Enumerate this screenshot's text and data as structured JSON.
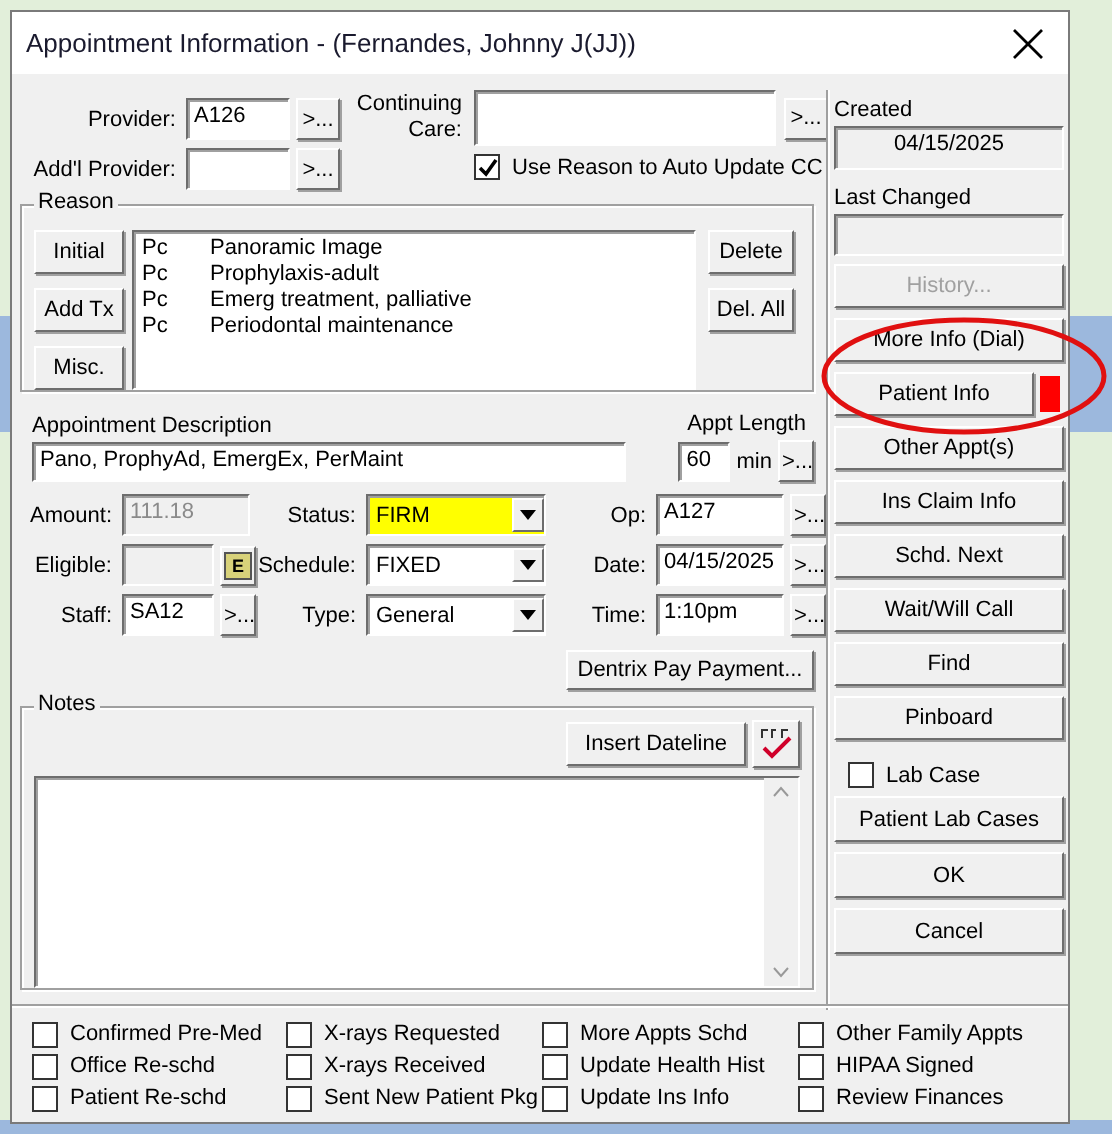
{
  "window": {
    "title": "Appointment Information - (Fernandes, Johnny J(JJ))"
  },
  "provider": {
    "label": "Provider:",
    "value": "A126",
    "button": ">..."
  },
  "addl_provider": {
    "label": "Add'l Provider:",
    "button": ">..."
  },
  "continuing_care": {
    "label": "Continuing Care:",
    "button": ">..."
  },
  "use_reason": {
    "label": "Use Reason to Auto Update CC",
    "checked": true
  },
  "reason": {
    "title": "Reason",
    "side_buttons": [
      "Initial",
      "Add Tx",
      "Misc."
    ],
    "items": [
      {
        "code": "Pc",
        "description": "Panoramic Image"
      },
      {
        "code": "Pc",
        "description": "Prophylaxis-adult"
      },
      {
        "code": "Pc",
        "description": "Emerg treatment, palliative"
      },
      {
        "code": "Pc",
        "description": "Periodontal maintenance"
      }
    ],
    "actions": [
      "Delete",
      "Del. All"
    ]
  },
  "appointment_description": {
    "label": "Appointment Description",
    "value": "Pano, ProphyAd, EmergEx, PerMaint"
  },
  "appt_length": {
    "label": "Appt Length",
    "value": "60",
    "unit": "min",
    "button": ">..."
  },
  "left_fields": [
    {
      "kind": "text",
      "label": "Amount:",
      "value": "111.18",
      "disabled": true
    },
    {
      "kind": "eligible",
      "label": "Eligible:",
      "button": "E",
      "disabled": true
    },
    {
      "kind": "browse",
      "label": "Staff:",
      "value": "SA12",
      "button": ">...",
      "disabled": false
    }
  ],
  "dropdowns": [
    {
      "label": "Status:",
      "value": "FIRM",
      "highlighted": true
    },
    {
      "label": "Schedule:",
      "value": "FIXED",
      "highlighted": false
    },
    {
      "label": "Type:",
      "value": "General",
      "highlighted": false
    }
  ],
  "right_fields": [
    {
      "label": "Op:",
      "value": "A127",
      "button": ">..."
    },
    {
      "label": "Date:",
      "value": "04/15/2025",
      "button": ">..."
    },
    {
      "label": "Time:",
      "value": "1:10pm",
      "button": ">..."
    }
  ],
  "dentrix_pay": "Dentrix Pay Payment...",
  "notes": {
    "title": "Notes",
    "insert_dateline": "Insert Dateline"
  },
  "created": {
    "label": "Created",
    "value": "04/15/2025"
  },
  "last_changed": {
    "label": "Last Changed"
  },
  "side_buttons": [
    {
      "label": "History...",
      "disabled": true
    },
    {
      "label": "More Info (Dial)",
      "disabled": false
    },
    {
      "label": "Patient Info",
      "disabled": false,
      "color": "#ff0000"
    },
    {
      "label": "Other Appt(s)",
      "disabled": false
    },
    {
      "label": "Ins Claim Info",
      "disabled": false
    },
    {
      "label": "Schd. Next",
      "disabled": false
    },
    {
      "label": "Wait/Will Call",
      "disabled": false
    },
    {
      "label": "Find",
      "disabled": false
    },
    {
      "label": "Pinboard",
      "disabled": false
    }
  ],
  "lab_case": {
    "label": "Lab Case",
    "checked": false
  },
  "bottom_buttons": [
    "Patient Lab Cases",
    "OK",
    "Cancel"
  ],
  "checkboxes": [
    {
      "label": "Confirmed Pre-Med",
      "checked": false
    },
    {
      "label": "Office Re-schd",
      "checked": false
    },
    {
      "label": "Patient Re-schd",
      "checked": false
    },
    {
      "label": "X-rays Requested",
      "checked": false
    },
    {
      "label": "X-rays Received",
      "checked": false
    },
    {
      "label": "Sent New Patient Pkg",
      "checked": false
    },
    {
      "label": "More Appts Schd",
      "checked": false
    },
    {
      "label": "Update Health Hist",
      "checked": false
    },
    {
      "label": "Update Ins Info",
      "checked": false
    },
    {
      "label": "Other Family Appts",
      "checked": false
    },
    {
      "label": "HIPAA Signed",
      "checked": false
    },
    {
      "label": "Review Finances",
      "checked": false
    }
  ]
}
